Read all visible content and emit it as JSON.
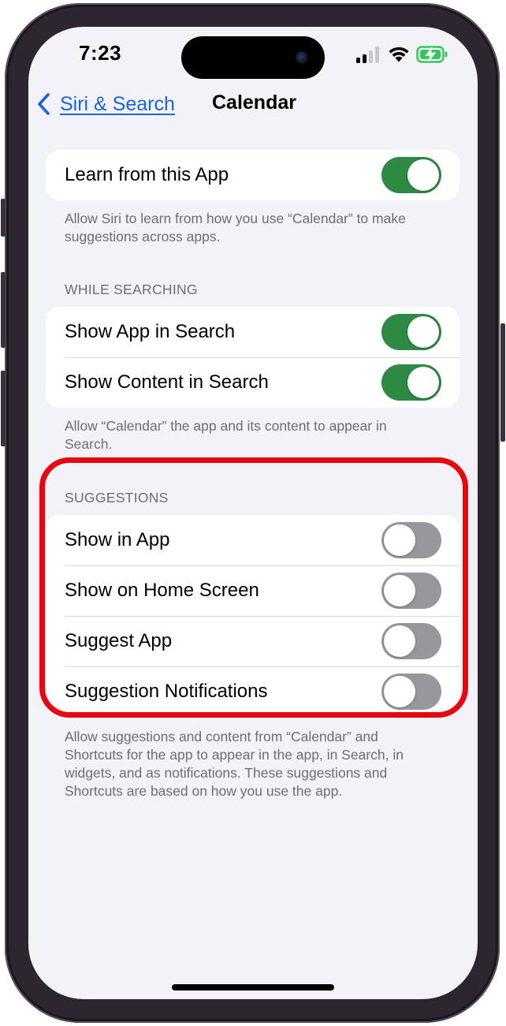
{
  "status_bar": {
    "time": "7:23",
    "icons": [
      "cellular-signal-icon",
      "wifi-icon",
      "battery-charging-icon"
    ],
    "battery_color": "#34c759"
  },
  "nav": {
    "back_label": "Siri & Search",
    "title": "Calendar"
  },
  "learn": {
    "label": "Learn from this App",
    "on": true,
    "footer": "Allow Siri to learn from how you use “Calendar” to make suggestions across apps."
  },
  "while_searching": {
    "header": "WHILE SEARCHING",
    "rows": [
      {
        "label": "Show App in Search",
        "on": true
      },
      {
        "label": "Show Content in Search",
        "on": true
      }
    ],
    "footer": "Allow “Calendar” the app and its content to appear in Search."
  },
  "suggestions": {
    "header": "SUGGESTIONS",
    "rows": [
      {
        "label": "Show in App",
        "on": false
      },
      {
        "label": "Show on Home Screen",
        "on": false
      },
      {
        "label": "Suggest App",
        "on": false
      },
      {
        "label": "Suggestion Notifications",
        "on": false
      }
    ],
    "footer": "Allow suggestions and content from “Calendar” and Shortcuts for the app to appear in the app, in Search, in widgets, and as notifications. These suggestions and Shortcuts are based on how you use the app."
  },
  "colors": {
    "toggle_on": "#2e8a43",
    "toggle_off": "#98979e",
    "link": "#1c64d8",
    "highlight": "#e8070e",
    "background": "#f2f2f7"
  }
}
